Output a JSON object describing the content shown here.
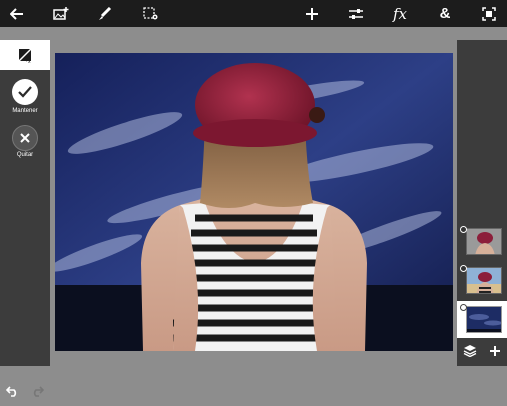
{
  "toolbar": {
    "left_icons": [
      "back-arrow-icon",
      "add-image-icon",
      "brush-icon",
      "selection-settings-icon"
    ],
    "right_icons": [
      "add-icon",
      "adjustments-icon",
      "fx-icon",
      "text-icon",
      "fullscreen-icon"
    ],
    "fx_label": "fx",
    "text_label": "&"
  },
  "left_panel": {
    "active_tool": "magic-eraser-icon",
    "keep_label": "Mantener",
    "remove_label": "Quitar",
    "undo": "undo-icon",
    "redo": "redo-icon"
  },
  "layers": {
    "items": [
      {
        "name": "woman-with-hat-layer",
        "selected": false
      },
      {
        "name": "woman-with-hat-beach-layer",
        "selected": false
      },
      {
        "name": "blue-sky-layer",
        "selected": true
      }
    ],
    "bottom": [
      "layers-icon",
      "add-layer-icon"
    ]
  },
  "colors": {
    "topbar": "#1c1c1c",
    "panel": "#3c3c3c",
    "workspace": "#8d8d8d",
    "sky": "#1d2c64",
    "hat": "#8c1e3a"
  }
}
